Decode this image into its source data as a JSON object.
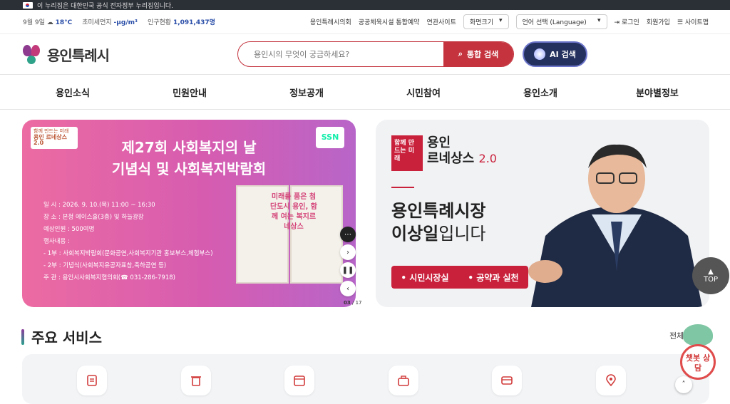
{
  "gov_notice": "이 누리집은 대한민국 공식 전자정부 누리집입니다.",
  "utility": {
    "date": "9월 9일",
    "temperature": "18°C",
    "fine_dust_label": "초미세먼지",
    "fine_dust_value": "-μg/m³",
    "population_label": "인구현황",
    "population_value": "1,091,437명",
    "links": [
      "용인특례시의회",
      "공공체육시설 통합예약",
      "연관사이트"
    ],
    "screen_size": "화면크기",
    "language": "언어 선택 (Language)",
    "login": "로그인",
    "signup": "회원가입",
    "sitemap": "사이트맵"
  },
  "header": {
    "logo_text": "용인특례시",
    "search_placeholder": "용인시의 무엇이 궁금하세요?",
    "search_button": "통합 검색",
    "ai_button": "AI 검색"
  },
  "gnb": [
    "용인소식",
    "민원안내",
    "정보공개",
    "시민참여",
    "용인소개",
    "분야별정보"
  ],
  "banner1": {
    "badge_small": "함께 만드는 미래",
    "badge_main": "용인 르네상스2.0",
    "ssn": "SSN",
    "title_line1": "제27회 사회복지의 날",
    "title_line2": "기념식 및 사회복지박람회",
    "info": [
      "일      시 : 2026. 9. 10.(목) 11:00 ~ 16:30",
      "장      소 : 본청 에이스홀(3층) 및 하늘광장",
      "예상인원 : 500여명",
      "행사내용 :",
      "- 1부 : 사회복지박람회(문화공연,사회복지기관 홍보부스,체험부스)",
      "- 2부 : 기념식(사회복지유공자표창,축하공연 등)",
      "주      관 : 용인시사회복지협의회(☎ 031-286-7918)"
    ],
    "poster_text": "미래를 품은 첨단도시 용인, 함께 여는 복지르네상스"
  },
  "slider": {
    "current": "03",
    "total": "17"
  },
  "banner2": {
    "logo_box": "함께 만드는 미래",
    "logo_main": "용인",
    "logo_sub": "르네상스",
    "logo_version": "2.0",
    "title_line1": "용인특례시장",
    "title_line2_bold": "이상일",
    "title_line2_rest": "입니다",
    "btn1": "시민시장실",
    "btn2": "공약과 실천"
  },
  "top_button": "TOP",
  "services": {
    "title": "주요 서비스",
    "all": "전체",
    "icons": [
      "document-icon",
      "trash-icon",
      "calendar-icon",
      "briefcase-icon",
      "card-icon",
      "location-icon"
    ]
  },
  "chatbot": "챗봇 상담",
  "colors": {
    "brand_red": "#c4333e",
    "ai_navy": "#24315e",
    "banner_pink": "#e86aa3"
  }
}
